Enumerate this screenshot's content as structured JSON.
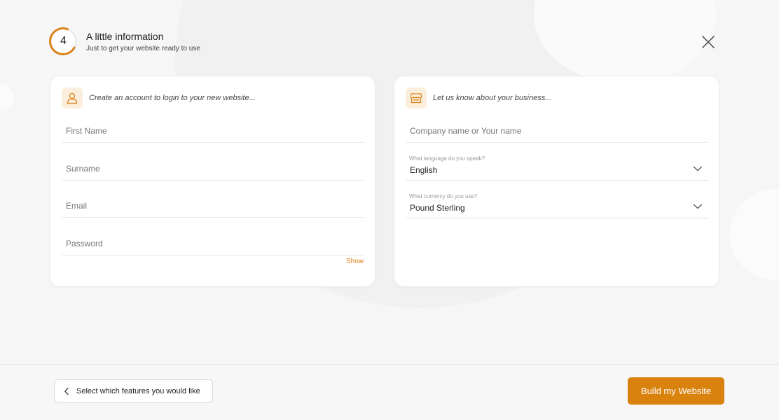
{
  "header": {
    "step": "4",
    "title": "A little information",
    "subtitle": "Just to get your website ready to use"
  },
  "account_card": {
    "heading": "Create an account to login to your new website...",
    "fields": {
      "first_name": {
        "placeholder": "First Name",
        "value": ""
      },
      "surname": {
        "placeholder": "Surname",
        "value": ""
      },
      "email": {
        "placeholder": "Email",
        "value": ""
      },
      "password": {
        "placeholder": "Password",
        "value": ""
      }
    },
    "show_label": "Show"
  },
  "business_card": {
    "heading": "Let us know about your business...",
    "company": {
      "placeholder": "Company name or Your name",
      "value": ""
    },
    "language": {
      "caption": "What language do you speak?",
      "value": "English"
    },
    "currency": {
      "caption": "What currency do you use?",
      "value": "Pound Sterling"
    }
  },
  "footer": {
    "back_label": "Select which features you would like",
    "build_label": "Build my Website"
  },
  "colors": {
    "accent": "#d9821a",
    "accent_light": "#fbeedd",
    "button": "#d9820e"
  },
  "icons": {
    "close": "close-icon",
    "user": "user-icon",
    "store": "store-icon",
    "chevron_down": "chevron-down-icon",
    "chevron_left": "chevron-left-icon"
  }
}
